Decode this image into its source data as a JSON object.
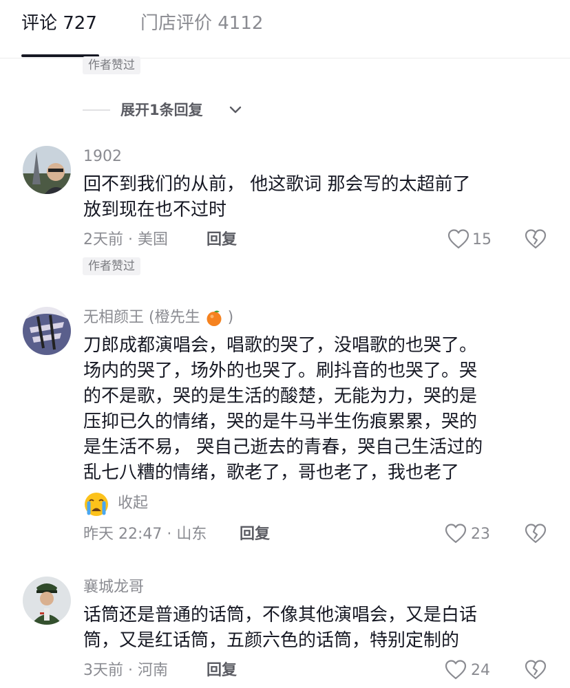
{
  "tabs": {
    "comments": "评论 727",
    "store_reviews": "门店评价 4112"
  },
  "author_liked_label": "作者赞过",
  "expand_replies": "展开1条回复",
  "comments": [
    {
      "username": "1902",
      "lines": [
        "回不到我们的从前， 他这歌词 那会写的太超前了",
        "放到现在也不过时"
      ],
      "meta": "2天前 · 美国",
      "reply": "回复",
      "likes": "15",
      "author_liked": "作者赞过"
    },
    {
      "username": "无相颜王 (橙先生",
      "username_suffix": ")",
      "lines": [
        "刀郎成都演唱会，唱歌的哭了，没唱歌的也哭了。",
        "场内的哭了，场外的也哭了。刷抖音的也哭了。哭",
        "的不是歌，哭的是生活的酸楚，无能为力，哭的是",
        "压抑已久的情绪，哭的是牛马半生伤痕累累，哭的",
        "是生活不易， 哭自己逝去的青春，哭自己生活过的",
        "乱七八糟的情绪，歌老了，哥也老了，我也老了"
      ],
      "collapse": "收起",
      "meta": "昨天 22:47 · 山东",
      "reply": "回复",
      "likes": "23"
    },
    {
      "username": "襄城龙哥",
      "lines": [
        "话筒还是普通的话筒，不像其他演唱会，又是白话",
        "筒，又是红话筒，五颜六色的话筒，特别定制的"
      ],
      "meta": "3天前 · 河南",
      "reply": "回复",
      "likes": "24"
    }
  ]
}
